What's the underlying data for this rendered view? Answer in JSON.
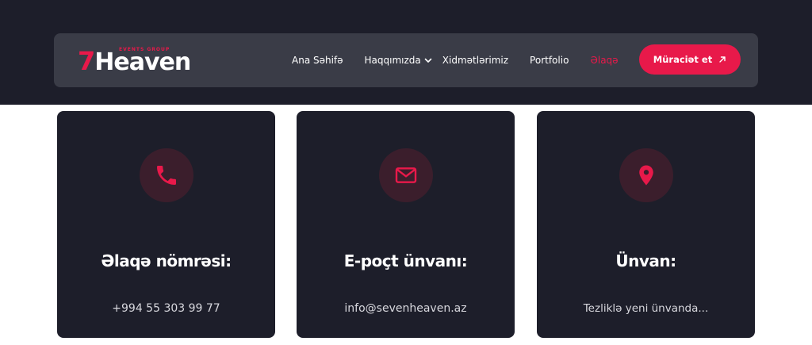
{
  "brand": {
    "logo_seven": "7",
    "logo_word": "Heaven",
    "logo_tagline": "EVENTS GROUP"
  },
  "nav": {
    "items": [
      {
        "label": "Ana Səhifə",
        "active": false
      },
      {
        "label": "Haqqımızda",
        "active": false,
        "dropdown": true
      },
      {
        "label": "Xidmətlərimiz",
        "active": false
      },
      {
        "label": "Portfolio",
        "active": false
      },
      {
        "label": "Əlaqə",
        "active": true
      }
    ],
    "cta_label": "Müraciət et",
    "cta_icon": "arrow-up-right-icon"
  },
  "cards": [
    {
      "icon": "phone-icon",
      "title": "Əlaqə nömrəsi:",
      "value": "+994 55 303 99 77"
    },
    {
      "icon": "mail-icon",
      "title": "E-poçt ünvanı:",
      "value": "info@sevenheaven.az"
    },
    {
      "icon": "location-pin-icon",
      "title": "Ünvan:",
      "value": "Tezliklə yeni ünvanda..."
    }
  ],
  "colors": {
    "accent": "#e8194a",
    "dark": "#1d1e2a",
    "navbar": "#3a3c47",
    "icon_bg": "#3b1e2c"
  }
}
